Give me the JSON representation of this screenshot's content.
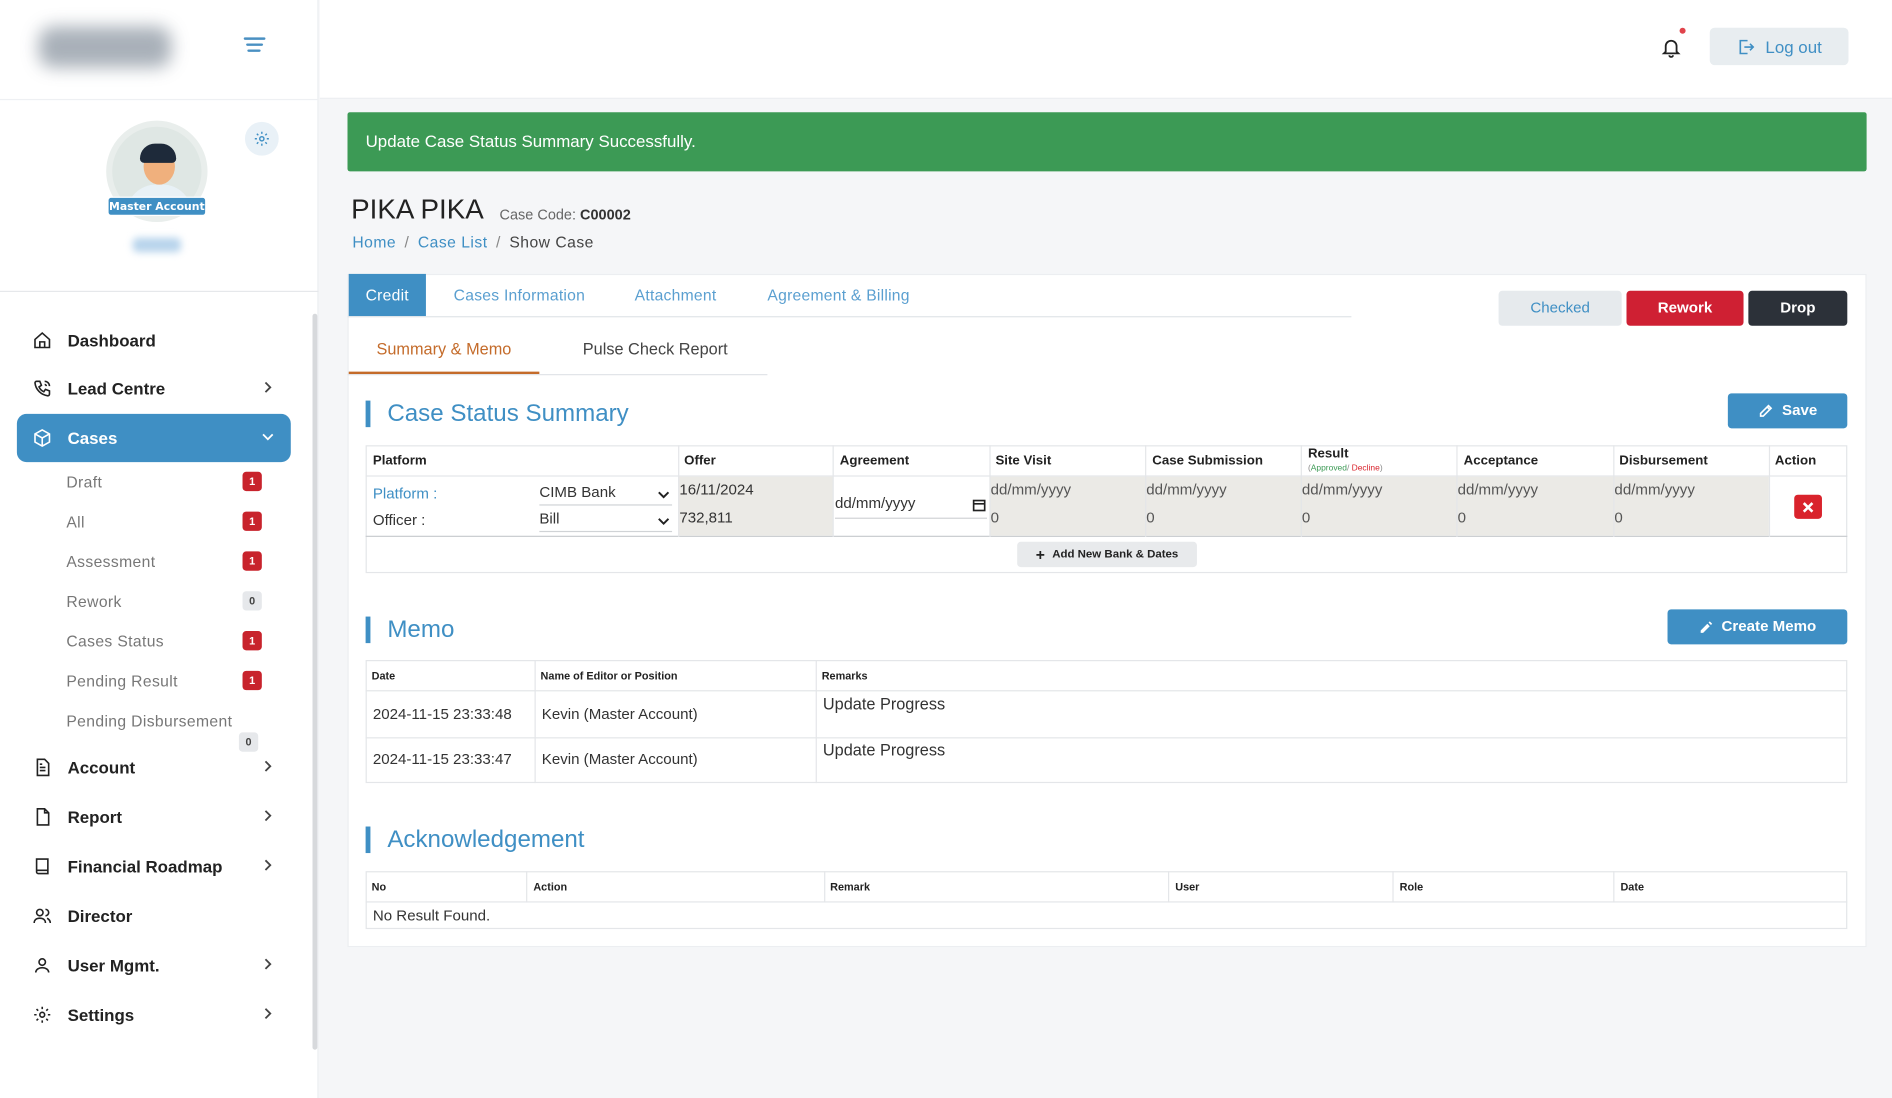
{
  "topbar": {
    "logout_label": "Log out"
  },
  "sidebar": {
    "badge": "Master Account",
    "nav": [
      {
        "label": "Dashboard"
      },
      {
        "label": "Lead Centre"
      },
      {
        "label": "Cases"
      },
      {
        "label": "Account"
      },
      {
        "label": "Report"
      },
      {
        "label": "Financial Roadmap"
      },
      {
        "label": "Director"
      },
      {
        "label": "User Mgmt."
      },
      {
        "label": "Settings"
      }
    ],
    "case_sub": [
      {
        "label": "Draft",
        "count": "1"
      },
      {
        "label": "All",
        "count": "1"
      },
      {
        "label": "Assessment",
        "count": "1"
      },
      {
        "label": "Rework",
        "count": "0"
      },
      {
        "label": "Cases Status",
        "count": "1"
      },
      {
        "label": "Pending Result",
        "count": "1"
      },
      {
        "label": "Pending Disbursement",
        "count": "0"
      }
    ]
  },
  "alert": "Update Case Status Summary Successfully.",
  "case": {
    "name": "PIKA PIKA",
    "code_label": "Case Code:",
    "code": "C00002"
  },
  "breadcrumb": {
    "home": "Home",
    "list": "Case List",
    "current": "Show Case",
    "sep": "/"
  },
  "tabs": [
    "Credit",
    "Cases Information",
    "Attachment",
    "Agreement & Billing"
  ],
  "subtabs": [
    "Summary & Memo",
    "Pulse Check Report"
  ],
  "actions": {
    "checked": "Checked",
    "rework": "Rework",
    "drop": "Drop"
  },
  "status_summary": {
    "title": "Case Status Summary",
    "save": "Save",
    "headers": [
      "Platform",
      "Offer",
      "Agreement",
      "Site Visit",
      "Case Submission",
      "Result",
      "Acceptance",
      "Disbursement",
      "Action"
    ],
    "result_sub": {
      "approved": "Approved",
      "decline": "Decline"
    },
    "row": {
      "platform_label": "Platform :",
      "officer_label": "Officer :",
      "platform_value": "CIMB Bank",
      "officer_value": "Bill",
      "offer_date": "16/11/2024",
      "offer_amount": "732,811",
      "agreement_placeholder": "dd/mm/yyyy",
      "site_visit": [
        "dd/mm/yyyy",
        "0"
      ],
      "submission": [
        "dd/mm/yyyy",
        "0"
      ],
      "result": [
        "dd/mm/yyyy",
        "0"
      ],
      "acceptance": [
        "dd/mm/yyyy",
        "0"
      ],
      "disbursement": [
        "dd/mm/yyyy",
        "0"
      ]
    },
    "add_bank": "Add New Bank & Dates"
  },
  "memo": {
    "title": "Memo",
    "create": "Create Memo",
    "headers": [
      "Date",
      "Name of Editor or Position",
      "Remarks"
    ],
    "rows": [
      {
        "date": "2024-11-15 23:33:48",
        "editor": "Kevin (Master Account)",
        "remarks": "Update Progress"
      },
      {
        "date": "2024-11-15 23:33:47",
        "editor": "Kevin (Master Account)",
        "remarks": "Update Progress"
      }
    ]
  },
  "ack": {
    "title": "Acknowledgement",
    "headers": [
      "No",
      "Action",
      "Remark",
      "User",
      "Role",
      "Date"
    ],
    "empty": "No Result Found."
  }
}
